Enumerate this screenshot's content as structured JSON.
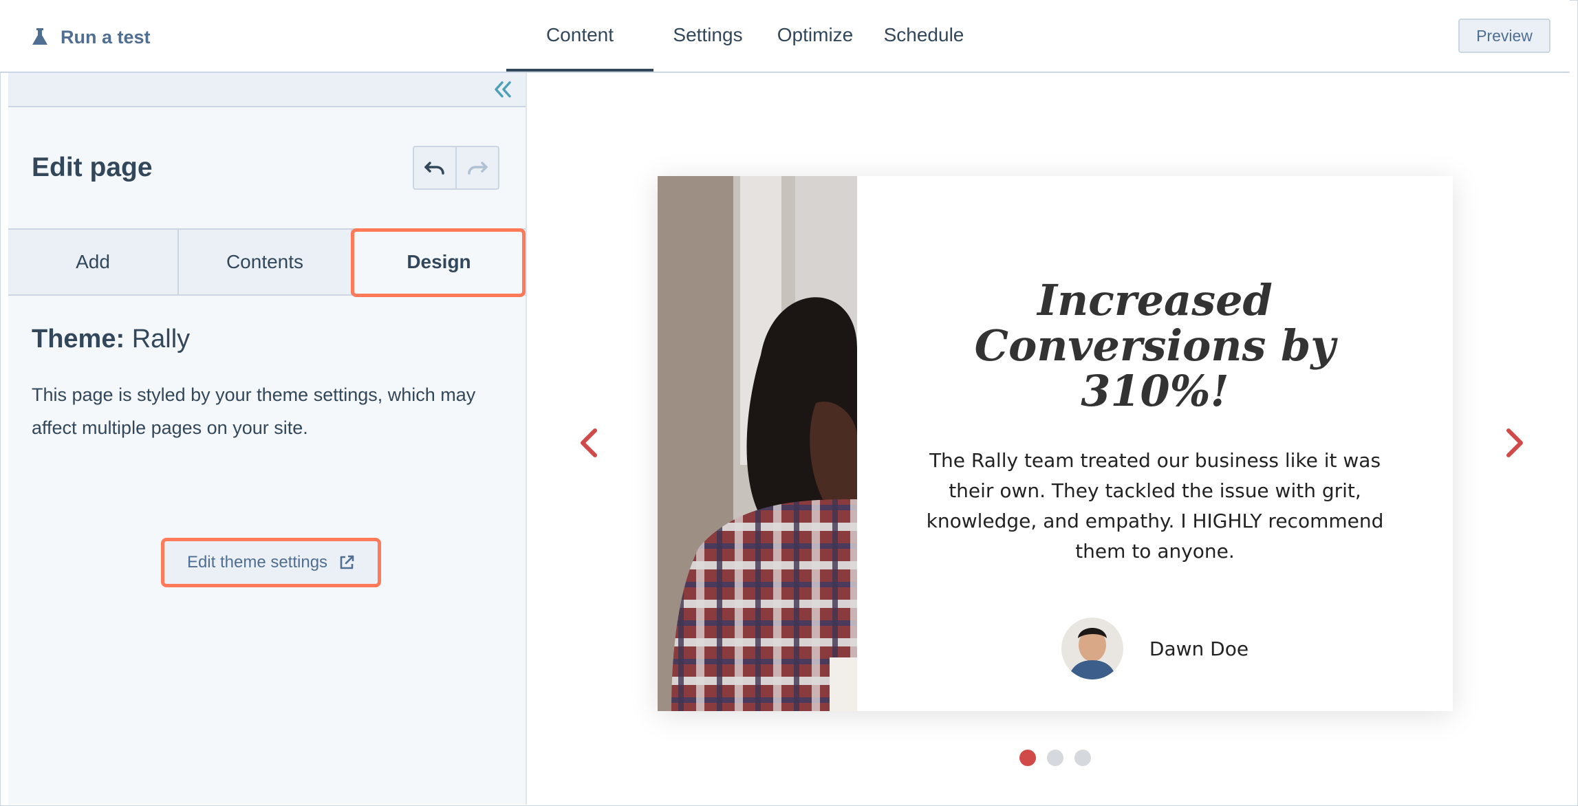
{
  "topbar": {
    "run_test_label": "Run a test",
    "tabs": [
      {
        "label": "Content",
        "active": true
      },
      {
        "label": "Settings",
        "active": false
      },
      {
        "label": "Optimize",
        "active": false
      },
      {
        "label": "Schedule",
        "active": false
      }
    ],
    "preview_label": "Preview"
  },
  "sidebar": {
    "title": "Edit page",
    "tabs": [
      {
        "label": "Add",
        "active": false
      },
      {
        "label": "Contents",
        "active": false
      },
      {
        "label": "Design",
        "active": true
      }
    ],
    "theme_label": "Theme:",
    "theme_name": "Rally",
    "description": "This page is styled by your theme settings, which may affect multiple pages on your site.",
    "edit_theme_label": "Edit theme settings"
  },
  "preview": {
    "headline": "Increased Conversions by 310%!",
    "quote": "The Rally team treated our business like it was their own. They tackled the issue with grit, knowledge, and empathy. I HIGHLY recommend them to anyone.",
    "author_name": "Dawn Doe",
    "slide_count": 3,
    "active_slide": 1
  },
  "colors": {
    "accent_highlight": "#ff7a59",
    "slider_arrow": "#d04a4a",
    "text_primary": "#33475b",
    "link": "#506e91"
  }
}
